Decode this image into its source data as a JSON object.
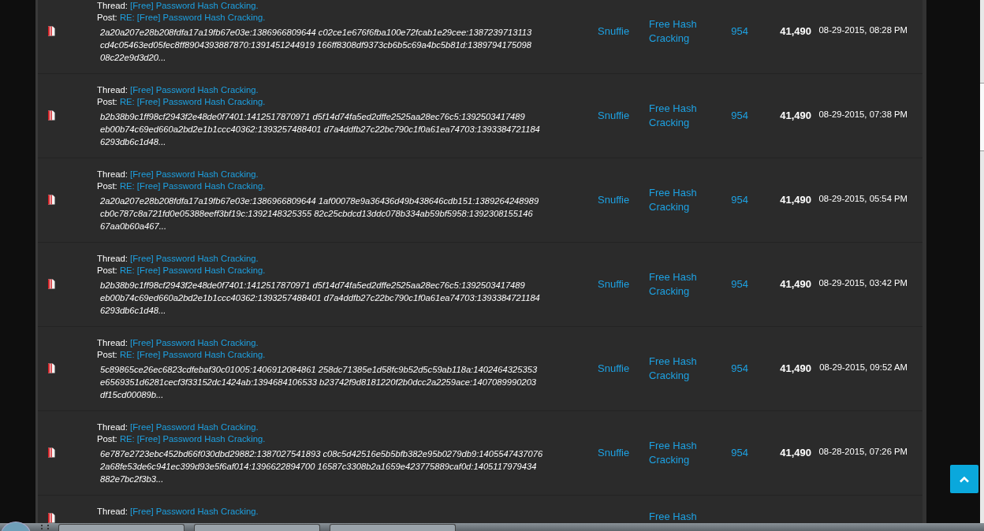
{
  "rows": [
    {
      "thread_label": "Thread:",
      "thread": "[Free] Password Hash Cracking.",
      "post_label": "Post:",
      "post": "RE: [Free] Password Hash Cracking.",
      "excerpt": "2a20a207e28b208fdfa17a19fb67e03e:1386966809644 c02ce1e676f6fba100e72fcab1e29cee:1387239713113 cd4c05463ed05fec8ff8904393887870:1391451244919 166ff8308df9373cb6b5c69a4bc5b81d:1389794175098 08c22e9d3d20...",
      "author": "Snuffie",
      "forum": "Free Hash Cracking",
      "replies": "954",
      "views": "41,490",
      "date": "08-29-2015, 08:28 PM"
    },
    {
      "thread_label": "Thread:",
      "thread": "[Free] Password Hash Cracking.",
      "post_label": "Post:",
      "post": "RE: [Free] Password Hash Cracking.",
      "excerpt": "b2b38b9c1ff98cf2943f2e48de0f7401:1412517870971 d5f14d74fa5ed2dffe2525aa28ec76c5:1392503417489 eb00b74c69ed660a2bd2e1b1ccc40362:1393257488401 d7a4ddfb27c22bc790c1f0a61ea74703:1393384721184 6293db6c1d48...",
      "author": "Snuffie",
      "forum": "Free Hash Cracking",
      "replies": "954",
      "views": "41,490",
      "date": "08-29-2015, 07:38 PM"
    },
    {
      "thread_label": "Thread:",
      "thread": "[Free] Password Hash Cracking.",
      "post_label": "Post:",
      "post": "RE: [Free] Password Hash Cracking.",
      "excerpt": "2a20a207e28b208fdfa17a19fb67e03e:1386966809644 1af00078e9a36436d49b438646cdb151:1389264248989 cb0c787c8a721fd0e05388eeff3bf19c:1392148325355 82c25cbdcd13ddc078b334ab59bf5958:1392308155146 67aa0b60a467...",
      "author": "Snuffie",
      "forum": "Free Hash Cracking",
      "replies": "954",
      "views": "41,490",
      "date": "08-29-2015, 05:54 PM"
    },
    {
      "thread_label": "Thread:",
      "thread": "[Free] Password Hash Cracking.",
      "post_label": "Post:",
      "post": "RE: [Free] Password Hash Cracking.",
      "excerpt": "b2b38b9c1ff98cf2943f2e48de0f7401:1412517870971 d5f14d74fa5ed2dffe2525aa28ec76c5:1392503417489 eb00b74c69ed660a2bd2e1b1ccc40362:1393257488401 d7a4ddfb27c22bc790c1f0a61ea74703:1393384721184 6293db6c1d48...",
      "author": "Snuffie",
      "forum": "Free Hash Cracking",
      "replies": "954",
      "views": "41,490",
      "date": "08-29-2015, 03:42 PM"
    },
    {
      "thread_label": "Thread:",
      "thread": "[Free] Password Hash Cracking.",
      "post_label": "Post:",
      "post": "RE: [Free] Password Hash Cracking.",
      "excerpt": "5c89865ce26ec6823cdfebaf30c01005:1406912084861 258dc71385e1d58fc9b52d5c59ab118a:1402464325353 e6569351d6281cecf3f33152dc1424ab:1394684106533 b23742f9d8181220f2b0dcc2a2259ace:1407089990203 df15cd00089b...",
      "author": "Snuffie",
      "forum": "Free Hash Cracking",
      "replies": "954",
      "views": "41,490",
      "date": "08-29-2015, 09:52 AM"
    },
    {
      "thread_label": "Thread:",
      "thread": "[Free] Password Hash Cracking.",
      "post_label": "Post:",
      "post": "RE: [Free] Password Hash Cracking.",
      "excerpt": "6e787e2723ebc452bd66f030dbd29882:1387027541893 c08c5d42516e5b5bfb382e95b0279db9:1405547437076 2a68fe53de6c941ec399d93e5f6af014:1396622894700 16587c3308b2a1659e423775889caf0d:1405117979434 882e7bc2f3b3...",
      "author": "Snuffie",
      "forum": "Free Hash Cracking",
      "replies": "954",
      "views": "41,490",
      "date": "08-28-2015, 07:26 PM"
    },
    {
      "thread_label": "Thread:",
      "thread": "[Free] Password Hash Cracking.",
      "forum": "Free Hash"
    }
  ]
}
